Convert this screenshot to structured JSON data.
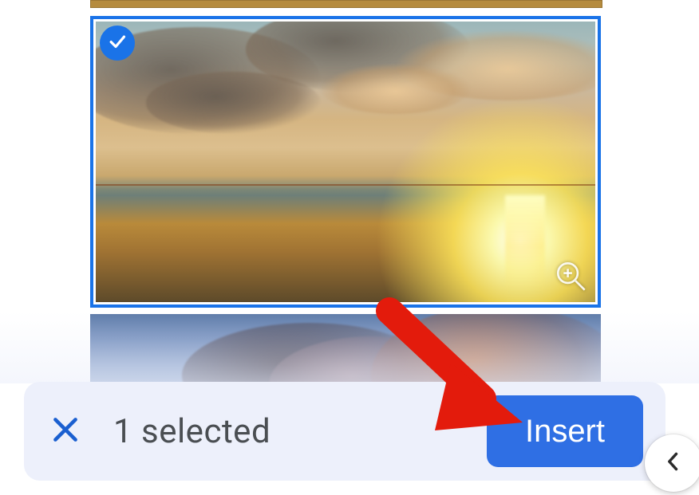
{
  "picker": {
    "selected_count_text": "1 selected",
    "insert_label": "Insert",
    "items": [
      {
        "selected": true,
        "alt": "Sunset over water with clouds"
      },
      {
        "selected": false,
        "alt": "Blue sky with orange-tinted clouds"
      }
    ]
  },
  "icons": {
    "check": "check-icon",
    "zoom": "zoom-in-icon",
    "close": "close-icon",
    "chevron_left": "chevron-left-icon"
  },
  "colors": {
    "accent": "#1a73e8",
    "button": "#2f6fe4",
    "bar_bg": "#edf0fb",
    "annotation_arrow": "#e31b0c"
  },
  "annotation": {
    "type": "arrow",
    "target": "insert-button"
  }
}
